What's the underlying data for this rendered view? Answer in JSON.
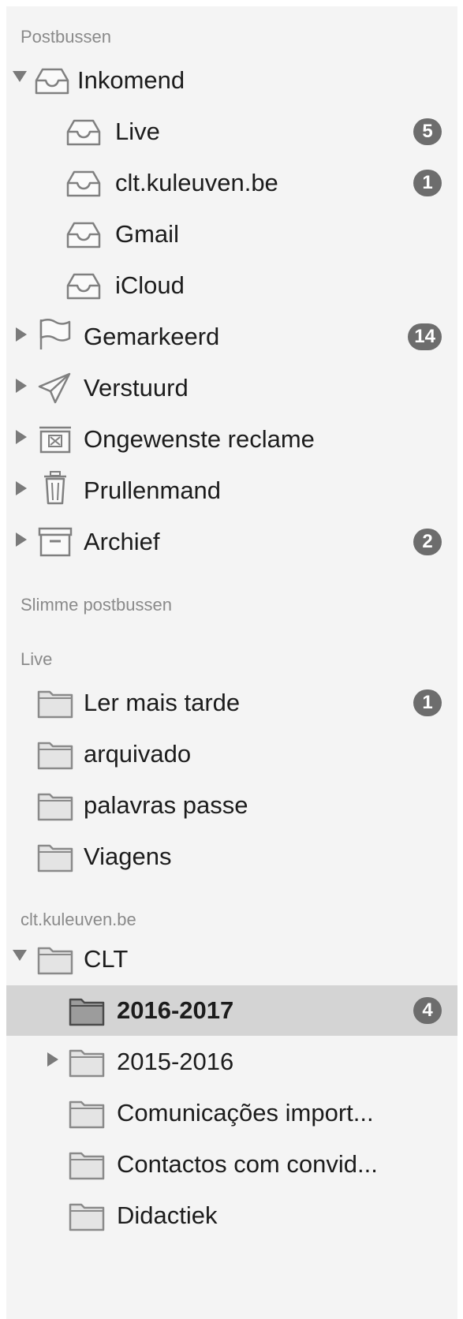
{
  "sections": {
    "mailboxes": "Postbussen",
    "smart": "Slimme postbussen",
    "live": "Live",
    "kuleuven": "clt.kuleuven.be"
  },
  "items": [
    {
      "label": "Inkomend",
      "icon": "inbox-icon",
      "expanded": true
    },
    {
      "label": "Live",
      "icon": "inbox-icon",
      "badge": "5"
    },
    {
      "label": "clt.kuleuven.be",
      "icon": "inbox-icon",
      "badge": "1"
    },
    {
      "label": "Gmail",
      "icon": "inbox-icon"
    },
    {
      "label": "iCloud",
      "icon": "inbox-icon"
    },
    {
      "label": "Gemarkeerd",
      "icon": "flag-icon",
      "badge": "14"
    },
    {
      "label": "Verstuurd",
      "icon": "paper-plane-icon"
    },
    {
      "label": "Ongewenste reclame",
      "icon": "junk-icon"
    },
    {
      "label": "Prullenmand",
      "icon": "trash-icon"
    },
    {
      "label": "Archief",
      "icon": "archive-icon",
      "badge": "2"
    },
    {
      "label": "Ler mais tarde",
      "icon": "folder-icon",
      "badge": "1"
    },
    {
      "label": "arquivado",
      "icon": "folder-icon"
    },
    {
      "label": "palavras passe",
      "icon": "folder-icon"
    },
    {
      "label": "Viagens",
      "icon": "folder-icon"
    },
    {
      "label": "CLT",
      "icon": "folder-icon",
      "expanded": true
    },
    {
      "label": "2016-2017",
      "icon": "folder-icon",
      "badge": "4",
      "selected": true
    },
    {
      "label": "2015-2016",
      "icon": "folder-icon"
    },
    {
      "label": "Comunicações import...",
      "icon": "folder-icon"
    },
    {
      "label": "Contactos com convid...",
      "icon": "folder-icon"
    },
    {
      "label": "Didactiek",
      "icon": "folder-icon"
    }
  ],
  "colors": {
    "sidebar_bg": "#f4f4f4",
    "selected_bg": "#d4d4d4",
    "badge_bg": "#6d6d6d",
    "header_text": "#8a8a8a"
  }
}
